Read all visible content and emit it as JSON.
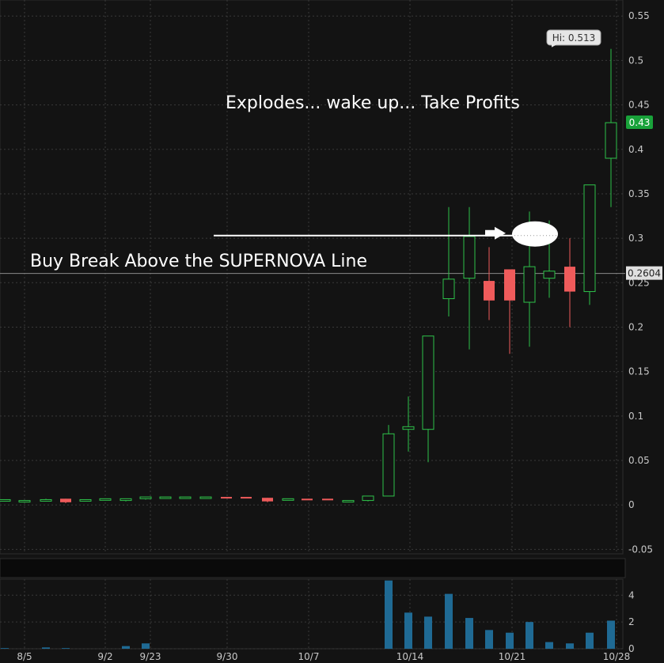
{
  "chart_data": {
    "type": "candlestick",
    "x_tick_labels": [
      "8/5",
      "9/2",
      "9/23",
      "9/30",
      "10/7",
      "10/14",
      "10/21",
      "10/28"
    ],
    "y_ticks": [
      0.55,
      0.5,
      0.45,
      0.4,
      0.35,
      0.3,
      0.25,
      0.2,
      0.15,
      0.1,
      0.05,
      0,
      -0.05
    ],
    "y_tick_labels": [
      "0.55",
      "0.5",
      "0.45",
      "0.4",
      "0.35",
      "0.3",
      "0.25",
      "0.2",
      "0.15",
      "0.1",
      "0.05",
      "0",
      "-0.05"
    ],
    "ylim": [
      -0.055,
      0.568
    ],
    "volume_ticks": [
      0,
      2,
      4
    ],
    "volume_tick_labels": [
      "0",
      "2",
      "4"
    ],
    "volume_ylim": [
      0,
      5.2
    ],
    "hi_label": "Hi: 0.513",
    "last_price_label": "0.43",
    "crosshair_price": 0.2604,
    "crosshair_label": "0.2604",
    "supernova_line_level": 0.303,
    "candles": [
      {
        "o": 0.005,
        "h": 0.006,
        "l": 0.004,
        "c": 0.006,
        "v": 0.05
      },
      {
        "o": 0.005,
        "h": 0.006,
        "l": 0.004,
        "c": 0.005,
        "v": 0.0
      },
      {
        "o": 0.005,
        "h": 0.007,
        "l": 0.004,
        "c": 0.006,
        "v": 0.1
      },
      {
        "o": 0.007,
        "h": 0.007,
        "l": 0.002,
        "c": 0.003,
        "v": 0.05
      },
      {
        "o": 0.006,
        "h": 0.007,
        "l": 0.005,
        "c": 0.006,
        "v": 0.0
      },
      {
        "o": 0.006,
        "h": 0.007,
        "l": 0.005,
        "c": 0.007,
        "v": 0.0
      },
      {
        "o": 0.005,
        "h": 0.007,
        "l": 0.004,
        "c": 0.007,
        "v": 0.2
      },
      {
        "o": 0.007,
        "h": 0.009,
        "l": 0.006,
        "c": 0.009,
        "v": 0.4
      },
      {
        "o": 0.008,
        "h": 0.009,
        "l": 0.007,
        "c": 0.009,
        "v": 0.0
      },
      {
        "o": 0.008,
        "h": 0.009,
        "l": 0.007,
        "c": 0.009,
        "v": 0.0
      },
      {
        "o": 0.009,
        "h": 0.009,
        "l": 0.008,
        "c": 0.009,
        "v": 0.0
      },
      {
        "o": 0.009,
        "h": 0.009,
        "l": 0.008,
        "c": 0.008,
        "v": 0.0
      },
      {
        "o": 0.009,
        "h": 0.009,
        "l": 0.008,
        "c": 0.008,
        "v": 0.0
      },
      {
        "o": 0.008,
        "h": 0.008,
        "l": 0.003,
        "c": 0.004,
        "v": 0.0
      },
      {
        "o": 0.007,
        "h": 0.007,
        "l": 0.006,
        "c": 0.007,
        "v": 0.0
      },
      {
        "o": 0.007,
        "h": 0.007,
        "l": 0.006,
        "c": 0.006,
        "v": 0.0
      },
      {
        "o": 0.007,
        "h": 0.007,
        "l": 0.006,
        "c": 0.006,
        "v": 0.0
      },
      {
        "o": 0.005,
        "h": 0.005,
        "l": 0.005,
        "c": 0.005,
        "v": 0.0
      },
      {
        "o": 0.005,
        "h": 0.01,
        "l": 0.004,
        "c": 0.01,
        "v": 0.0
      },
      {
        "o": 0.01,
        "h": 0.09,
        "l": 0.01,
        "c": 0.08,
        "v": 5.1
      },
      {
        "o": 0.085,
        "h": 0.122,
        "l": 0.06,
        "c": 0.088,
        "v": 2.7
      },
      {
        "o": 0.085,
        "h": 0.19,
        "l": 0.048,
        "c": 0.19,
        "v": 2.4
      },
      {
        "o": 0.232,
        "h": 0.335,
        "l": 0.212,
        "c": 0.254,
        "v": 4.1
      },
      {
        "o": 0.255,
        "h": 0.335,
        "l": 0.175,
        "c": 0.302,
        "v": 2.3
      },
      {
        "o": 0.252,
        "h": 0.29,
        "l": 0.208,
        "c": 0.23,
        "v": 1.4
      },
      {
        "o": 0.265,
        "h": 0.265,
        "l": 0.17,
        "c": 0.23,
        "v": 1.2
      },
      {
        "o": 0.228,
        "h": 0.33,
        "l": 0.178,
        "c": 0.268,
        "v": 2.0
      },
      {
        "o": 0.255,
        "h": 0.32,
        "l": 0.233,
        "c": 0.263,
        "v": 0.5
      },
      {
        "o": 0.268,
        "h": 0.3,
        "l": 0.2,
        "c": 0.24,
        "v": 0.4
      },
      {
        "o": 0.24,
        "h": 0.36,
        "l": 0.225,
        "c": 0.36,
        "v": 1.2
      },
      {
        "o": 0.39,
        "h": 0.513,
        "l": 0.335,
        "c": 0.43,
        "v": 2.1
      }
    ],
    "annotations": [
      "Explodes... wake up... Take Profits",
      "Buy Break Above the SUPERNOVA Line"
    ],
    "colors": {
      "up": "#2ec24a",
      "down": "#ef5b5b",
      "volume": "#1f6a94",
      "background": "#131313",
      "grid": "#3a3a3a",
      "last_price_badge": "#19a23a"
    }
  }
}
